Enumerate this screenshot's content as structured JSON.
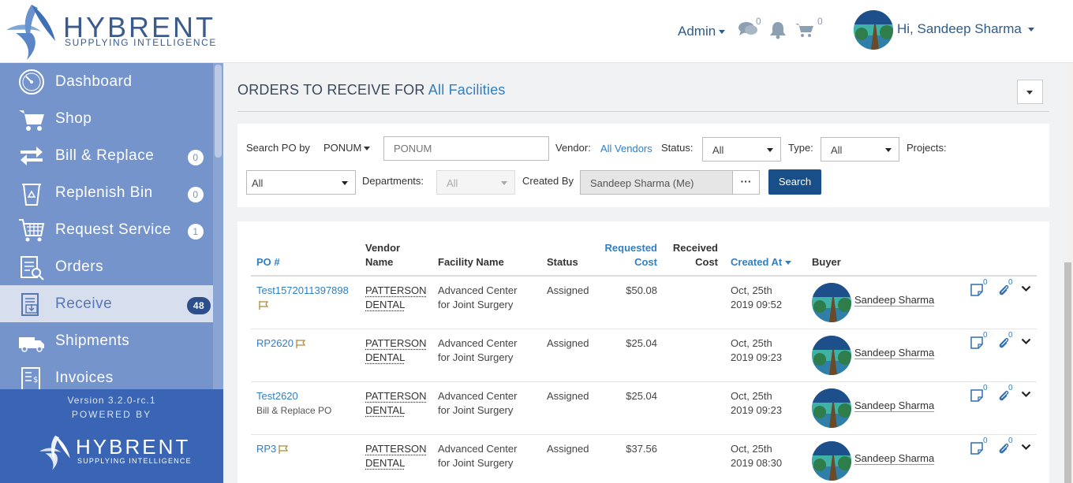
{
  "brand": {
    "name": "HYBRENT",
    "tagline": "SUPPLYING INTELLIGENCE"
  },
  "header": {
    "admin_label": "Admin",
    "messages_count": "0",
    "cart_count": "0",
    "greeting": "Hi, Sandeep Sharma"
  },
  "sidebar": {
    "items": [
      {
        "label": "Dashboard",
        "icon": "dashboard-icon",
        "badge": ""
      },
      {
        "label": "Shop",
        "icon": "cart-icon",
        "badge": ""
      },
      {
        "label": "Bill & Replace",
        "icon": "bill-replace-icon",
        "badge": "0"
      },
      {
        "label": "Replenish Bin",
        "icon": "recycle-bin-icon",
        "badge": "0"
      },
      {
        "label": "Request Service",
        "icon": "service-cart-icon",
        "badge": "1"
      },
      {
        "label": "Orders",
        "icon": "orders-icon",
        "badge": ""
      },
      {
        "label": "Receive",
        "icon": "receive-icon",
        "badge": "48"
      },
      {
        "label": "Shipments",
        "icon": "truck-icon",
        "badge": ""
      },
      {
        "label": "Invoices",
        "icon": "invoice-icon",
        "badge": ""
      }
    ],
    "version": "Version 3.2.0-rc.1",
    "powered_by": "POWERED BY"
  },
  "page": {
    "title_prefix": "ORDERS TO RECEIVE FOR",
    "facility": "All Facilities"
  },
  "filters": {
    "search_po_label": "Search PO by",
    "search_po_by": "PONUM",
    "search_placeholder": "PONUM",
    "vendor_label": "Vendor:",
    "vendor_value": "All Vendors",
    "status_label": "Status:",
    "status_value": "All",
    "type_label": "Type:",
    "type_value": "All",
    "projects_label": "Projects:",
    "projects_value": "All",
    "departments_label": "Departments:",
    "departments_value": "All",
    "created_by_label": "Created By",
    "created_by_value": "Sandeep Sharma (Me)",
    "more_label": "···",
    "search_button": "Search"
  },
  "table": {
    "columns": {
      "po": "PO #",
      "vendor_1": "Vendor",
      "vendor_2": "Name",
      "facility": "Facility Name",
      "status": "Status",
      "requested_1": "Requested",
      "requested_2": "Cost",
      "received_1": "Received",
      "received_2": "Cost",
      "created": "Created At",
      "buyer": "Buyer"
    },
    "rows": [
      {
        "po": "Test1572011397898",
        "sub": "",
        "flag": true,
        "vendor_1": "PATTERSON",
        "vendor_2": "DENTAL",
        "facility_1": "Advanced Center",
        "facility_2": "for Joint Surgery",
        "status": "Assigned",
        "requested": "$50.08",
        "received": "",
        "date": "Oct, 25th",
        "time": "2019 09:52",
        "buyer": "Sandeep Sharma",
        "notes": "0",
        "attachments": "0"
      },
      {
        "po": "RP2620",
        "sub": "",
        "flag": true,
        "vendor_1": "PATTERSON",
        "vendor_2": "DENTAL",
        "facility_1": "Advanced Center",
        "facility_2": "for Joint Surgery",
        "status": "Assigned",
        "requested": "$25.04",
        "received": "",
        "date": "Oct, 25th",
        "time": "2019 09:23",
        "buyer": "Sandeep Sharma",
        "notes": "0",
        "attachments": "0"
      },
      {
        "po": "Test2620",
        "sub": "Bill & Replace PO",
        "flag": false,
        "vendor_1": "PATTERSON",
        "vendor_2": "DENTAL",
        "facility_1": "Advanced Center",
        "facility_2": "for Joint Surgery",
        "status": "Assigned",
        "requested": "$25.04",
        "received": "",
        "date": "Oct, 25th",
        "time": "2019 09:23",
        "buyer": "Sandeep Sharma",
        "notes": "0",
        "attachments": "0"
      },
      {
        "po": "RP3",
        "sub": "",
        "flag": true,
        "vendor_1": "PATTERSON",
        "vendor_2": "DENTAL",
        "facility_1": "Advanced Center",
        "facility_2": "for Joint Surgery",
        "status": "Assigned",
        "requested": "$37.56",
        "received": "",
        "date": "Oct, 25th",
        "time": "2019 08:30",
        "buyer": "Sandeep Sharma",
        "notes": "0",
        "attachments": "0"
      }
    ]
  },
  "colors": {
    "sidebar": "#7494cb",
    "sidebar_footer": "#3a65b5",
    "accent": "#2f7fc1",
    "search_button": "#184f8a"
  }
}
